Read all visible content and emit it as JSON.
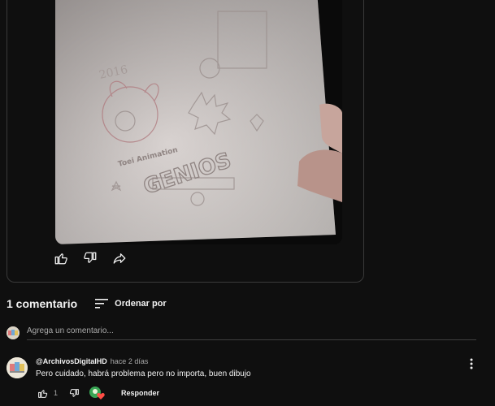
{
  "post": {
    "image_alt": "Dibujo a lápiz en papel",
    "drawing_text": [
      "2016",
      "GENIOS",
      "Toei Animation"
    ]
  },
  "comments": {
    "count_label": "1 comentario",
    "sort_label": "Ordenar por",
    "add_placeholder": "Agrega un comentario...",
    "items": [
      {
        "author": "@ArchivosDigitalHD",
        "timestamp": "hace 2 días",
        "text": "Pero cuidado, habrá problema pero no importa, buen dibujo",
        "likes": "1",
        "reply_label": "Responder"
      }
    ]
  },
  "colors": {
    "background": "#0f0f0f",
    "text": "#f1f1f1",
    "secondary_text": "#aaaaaa",
    "heart": "#ff4e45"
  },
  "icons": [
    "thumbs-up-icon",
    "thumbs-down-icon",
    "share-icon",
    "sort-icon",
    "kebab-menu-icon",
    "heart-icon"
  ]
}
